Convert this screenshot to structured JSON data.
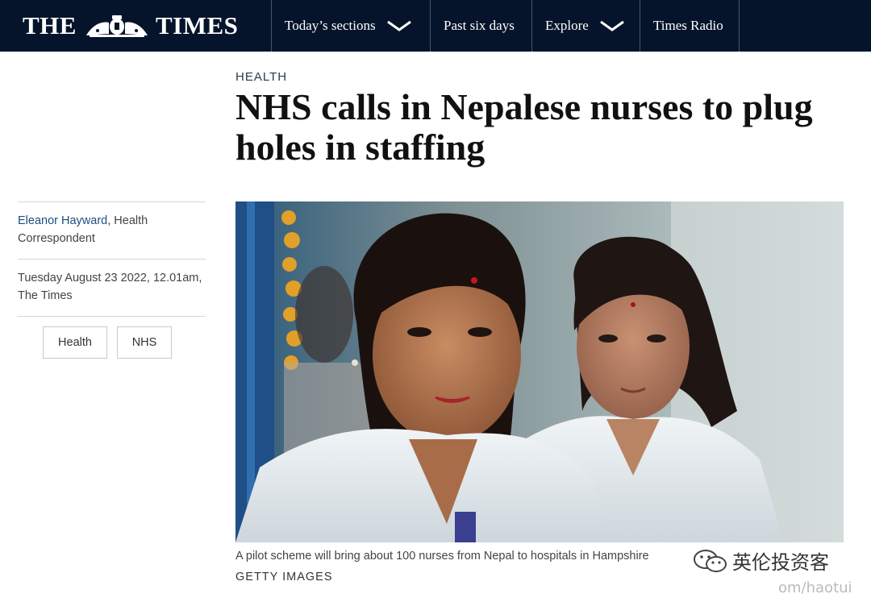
{
  "header": {
    "logo_left": "THE",
    "logo_right": "TIMES",
    "nav": [
      {
        "label": "Today’s sections",
        "has_dropdown": true
      },
      {
        "label": "Past six days",
        "has_dropdown": false
      },
      {
        "label": "Explore",
        "has_dropdown": true
      },
      {
        "label": "Times Radio",
        "has_dropdown": false
      }
    ],
    "colors": {
      "bar": "#06142b",
      "text": "#ffffff"
    }
  },
  "article": {
    "section": "HEALTH",
    "headline": "NHS calls in Nepalese nurses to plug holes in staffing",
    "byline": {
      "author": "Eleanor Hayward",
      "role": ", Health Correspondent"
    },
    "dateline": "Tuesday August 23 2022, 12.01am, The Times",
    "tags": [
      "Health",
      "NHS"
    ],
    "image": {
      "caption": "A pilot scheme will bring about 100 nurses from Nepal to hospitals in Hampshire",
      "credit": "GETTY IMAGES"
    },
    "colors": {
      "author_link": "#1b4e7e"
    }
  },
  "watermark": {
    "icon": "wechat-icon",
    "text": "英伦投资客",
    "sub": "om/haotui"
  }
}
